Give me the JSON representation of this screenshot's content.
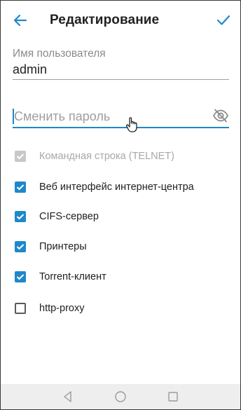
{
  "header": {
    "title": "Редактирование",
    "back_icon": "arrow-left-icon",
    "save_icon": "checkmark-icon"
  },
  "username": {
    "label": "Имя пользователя",
    "value": "admin"
  },
  "password": {
    "placeholder": "Сменить пароль",
    "visibility_icon": "eye-off-icon"
  },
  "permissions": [
    {
      "label": "Командная строка (TELNET)",
      "checked": true,
      "disabled": true
    },
    {
      "label": "Веб интерфейс интернет-центра",
      "checked": true,
      "disabled": false
    },
    {
      "label": "CIFS-сервер",
      "checked": true,
      "disabled": false
    },
    {
      "label": "Принтеры",
      "checked": true,
      "disabled": false
    },
    {
      "label": "Torrent-клиент",
      "checked": true,
      "disabled": false
    },
    {
      "label": "http-proxy",
      "checked": false,
      "disabled": false
    }
  ],
  "navbar": {
    "icons": [
      "nav-back-icon",
      "nav-home-icon",
      "nav-recents-icon"
    ]
  },
  "colors": {
    "accent": "#1e88c9",
    "text": "#212121",
    "hint": "#9e9e9e",
    "disabled": "#c8c8c8"
  }
}
